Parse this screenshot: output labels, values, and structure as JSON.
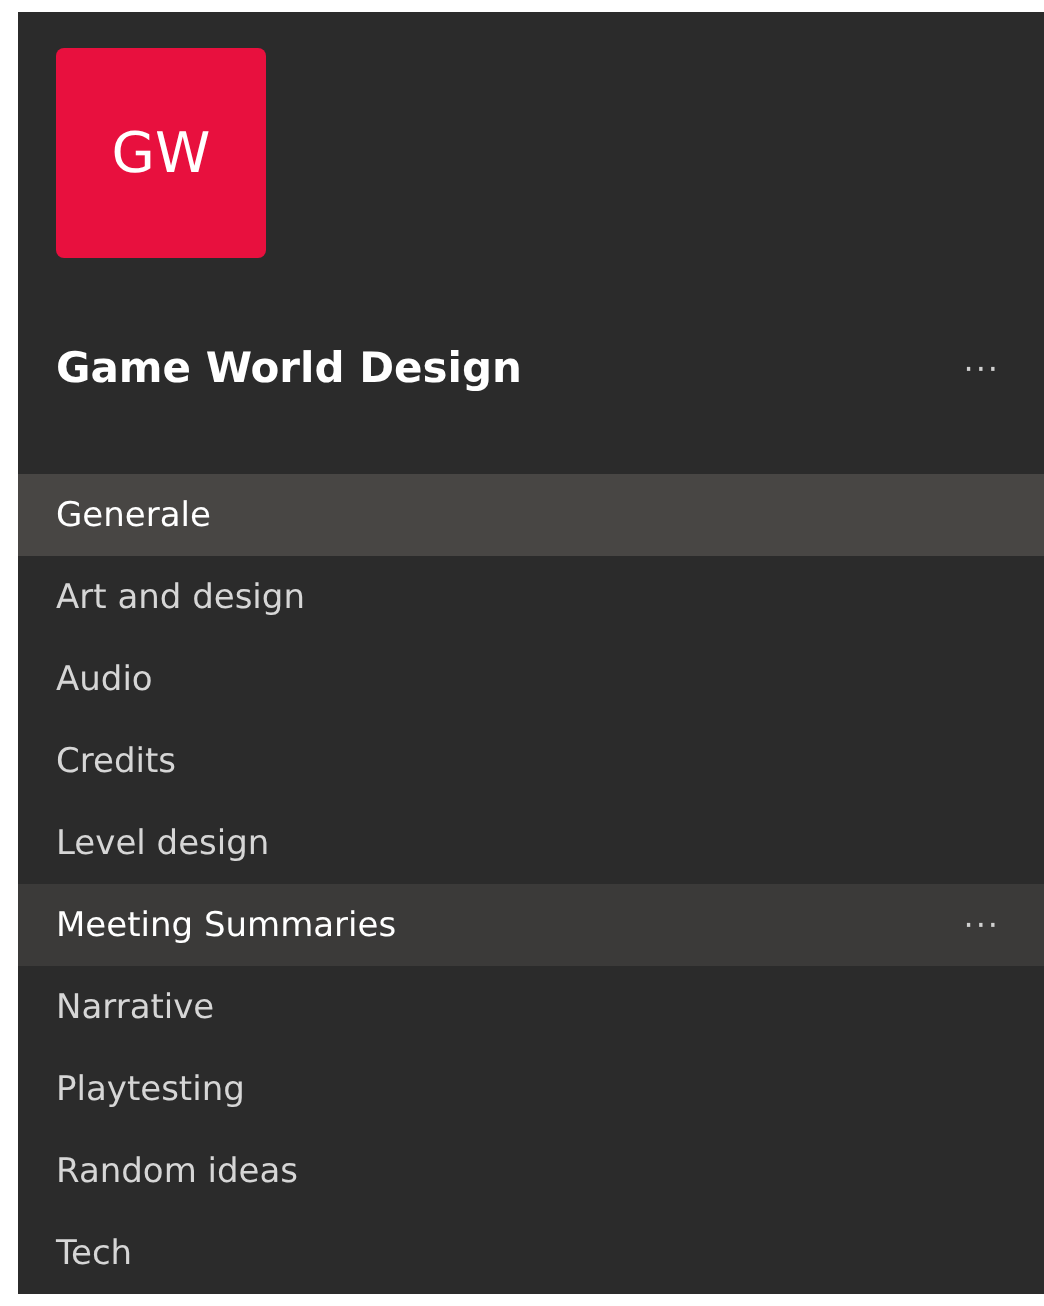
{
  "team": {
    "initials": "GW",
    "color": "#e8103e",
    "name": "Game World Design",
    "more": "···"
  },
  "channels": [
    {
      "name": "Generale",
      "selected": true,
      "hovered": false
    },
    {
      "name": "Art and design",
      "selected": false,
      "hovered": false
    },
    {
      "name": "Audio",
      "selected": false,
      "hovered": false
    },
    {
      "name": "Credits",
      "selected": false,
      "hovered": false
    },
    {
      "name": "Level design",
      "selected": false,
      "hovered": false
    },
    {
      "name": "Meeting Summaries",
      "selected": false,
      "hovered": true,
      "more": "···"
    },
    {
      "name": "Narrative",
      "selected": false,
      "hovered": false
    },
    {
      "name": "Playtesting",
      "selected": false,
      "hovered": false
    },
    {
      "name": "Random ideas",
      "selected": false,
      "hovered": false
    },
    {
      "name": "Tech",
      "selected": false,
      "hovered": false
    }
  ]
}
